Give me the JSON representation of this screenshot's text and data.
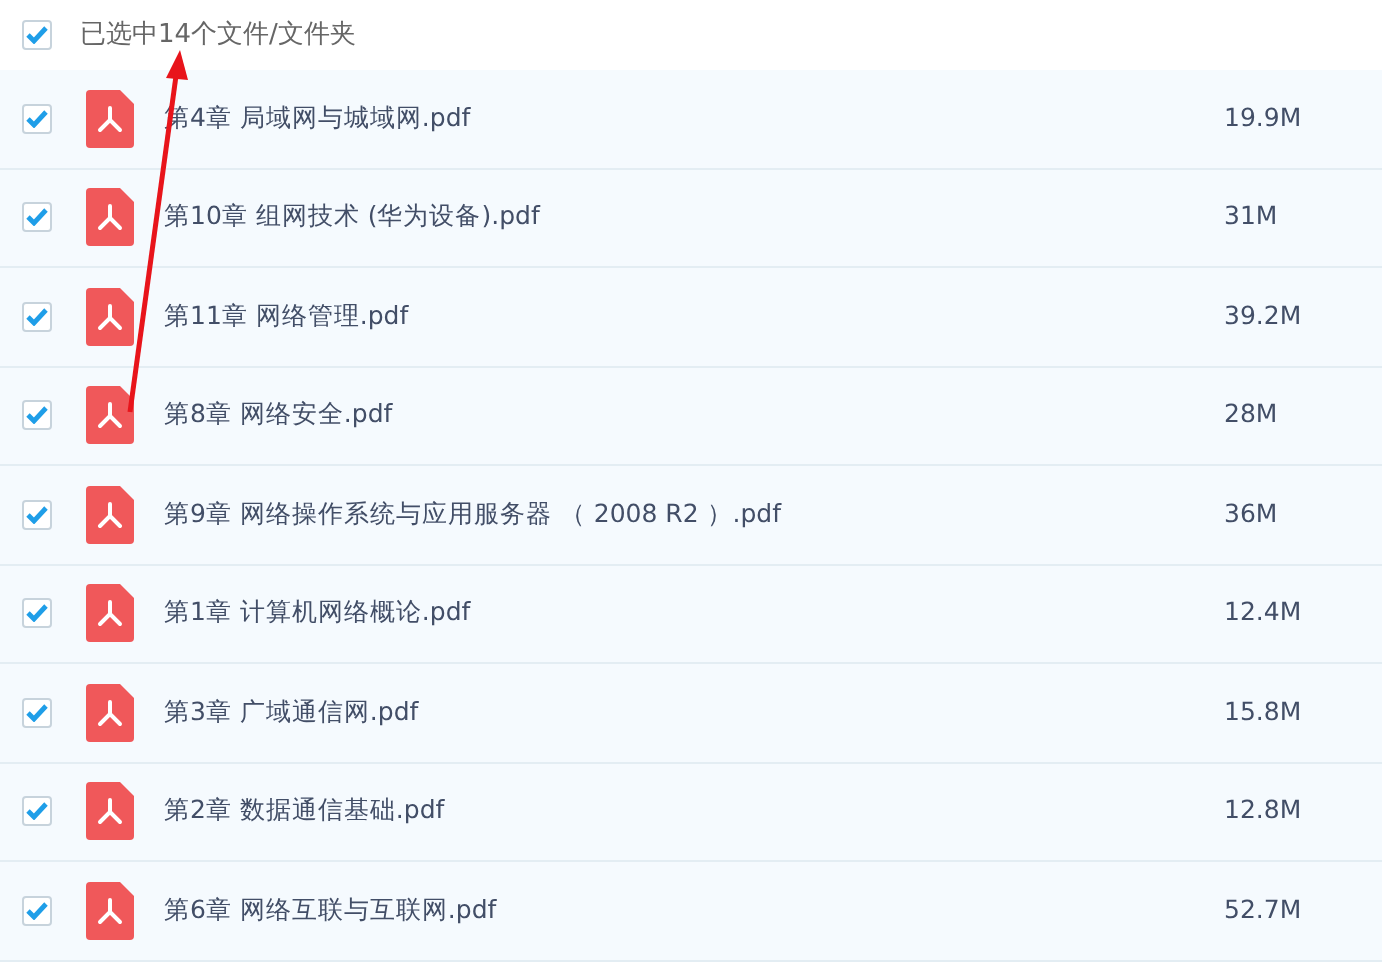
{
  "header": {
    "checked": true,
    "label": "已选中14个文件/文件夹"
  },
  "files": [
    {
      "name": "第4章 局域网与城域网.pdf",
      "size": "19.9M",
      "checked": true
    },
    {
      "name": "第10章 组网技术 (华为设备).pdf",
      "size": "31M",
      "checked": true
    },
    {
      "name": "第11章 网络管理.pdf",
      "size": "39.2M",
      "checked": true
    },
    {
      "name": "第8章 网络安全.pdf",
      "size": "28M",
      "checked": true
    },
    {
      "name": "第9章 网络操作系统与应用服务器 （ 2008 R2 ）.pdf",
      "size": "36M",
      "checked": true
    },
    {
      "name": "第1章 计算机网络概论.pdf",
      "size": "12.4M",
      "checked": true
    },
    {
      "name": "第3章 广域通信网.pdf",
      "size": "15.8M",
      "checked": true
    },
    {
      "name": "第2章 数据通信基础.pdf",
      "size": "12.8M",
      "checked": true
    },
    {
      "name": "第6章 网络互联与互联网.pdf",
      "size": "52.7M",
      "checked": true
    }
  ]
}
